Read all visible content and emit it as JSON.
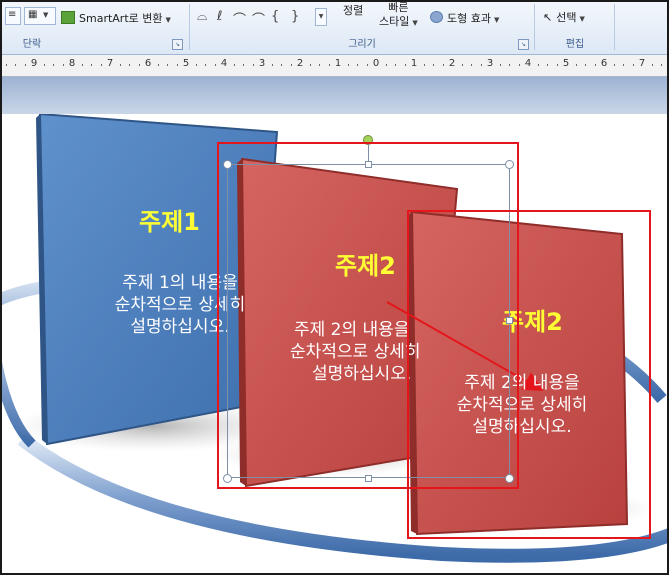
{
  "ribbon": {
    "smartart_label": "SmartArt로 변환",
    "arrange_label": "정렬",
    "quick_style_line1": "빠른",
    "quick_style_line2": "스타일",
    "shape_effect_label": "도형 효과",
    "select_label": "선택",
    "groups": {
      "paragraph": "단락",
      "drawing": "그리기",
      "editing": "편집"
    }
  },
  "ruler": {
    "numbers": [
      "9",
      "8",
      "7",
      "6",
      "5",
      "4",
      "3",
      "2",
      "1",
      "0",
      "1",
      "2",
      "3",
      "4",
      "5",
      "6",
      "7"
    ]
  },
  "slide": {
    "cards": [
      {
        "title": "주제1",
        "lines": [
          "주제 1의 내용을",
          "순차적으로 상세히",
          "설명하십시오."
        ]
      },
      {
        "title": "주제2",
        "lines": [
          "주제 2의 내용을",
          "순차적으로 상세히",
          "설명하십시오."
        ]
      },
      {
        "title": "주제2",
        "lines": [
          "주제 2의 내용을",
          "순차적으로 상세히",
          "설명하십시오."
        ]
      }
    ]
  },
  "colors": {
    "card_blue": "#4f81bd",
    "card_red": "#c0504d",
    "title_yellow": "#ffff33",
    "annotation_red": "#e5161b"
  }
}
